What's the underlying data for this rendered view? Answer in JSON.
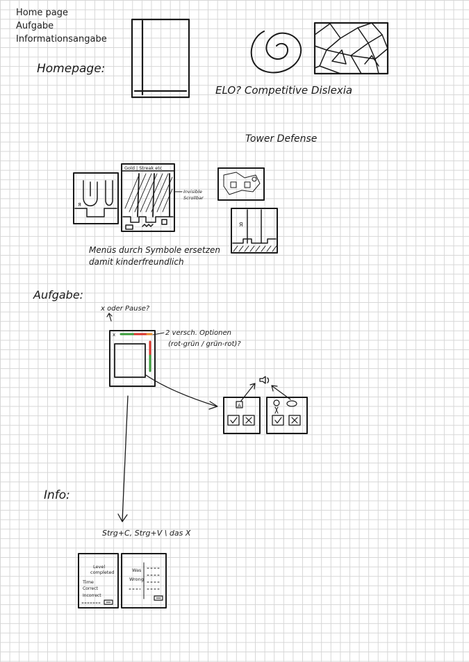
{
  "nav": {
    "items": [
      {
        "label": "Home page"
      },
      {
        "label": "Aufgabe"
      },
      {
        "label": "Informationsangabe"
      }
    ]
  },
  "sections": {
    "homepage": "Homepage:",
    "aufgabe": "Aufgabe:",
    "info": "Info:"
  },
  "notes": {
    "elo": "ELO? Competitive Dislexia",
    "tower": "Tower Defense",
    "gold": "Gold | Streak etc",
    "scrollbar_1": "Invisible",
    "scrollbar_2": "Scrollbar",
    "menus_1": "Menüs durch Symbole ersetzen",
    "menus_2": "damit kinderfreundlich",
    "pause": "x oder Pause?",
    "options_1": "2 versch. Optionen",
    "options_2": "(rot-grün / grün-rot)?",
    "shortcut": "Strg+C, Strg+V  \\  das X",
    "level_1": "Level",
    "level_2": "completed",
    "time": "Time",
    "correct": "Correct",
    "incorrect": "Incorrect",
    "row_1": "Was",
    "row_2": "Wrong"
  },
  "colors": {
    "ink": "#1a1a1a",
    "red": "#d9342b",
    "green": "#3a9c3a",
    "orange": "#e88a2a"
  }
}
